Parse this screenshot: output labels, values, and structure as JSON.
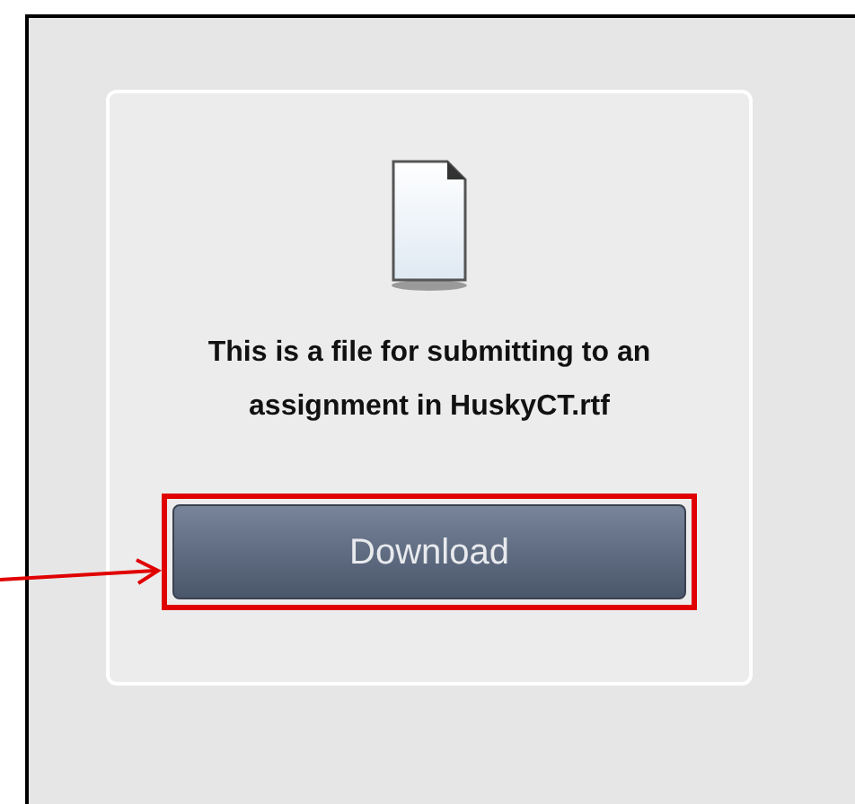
{
  "file_card": {
    "file_name": "This is a file for submitting to an assignment in HuskyCT.rtf",
    "button": {
      "label": "Download",
      "highlighted": true
    }
  }
}
